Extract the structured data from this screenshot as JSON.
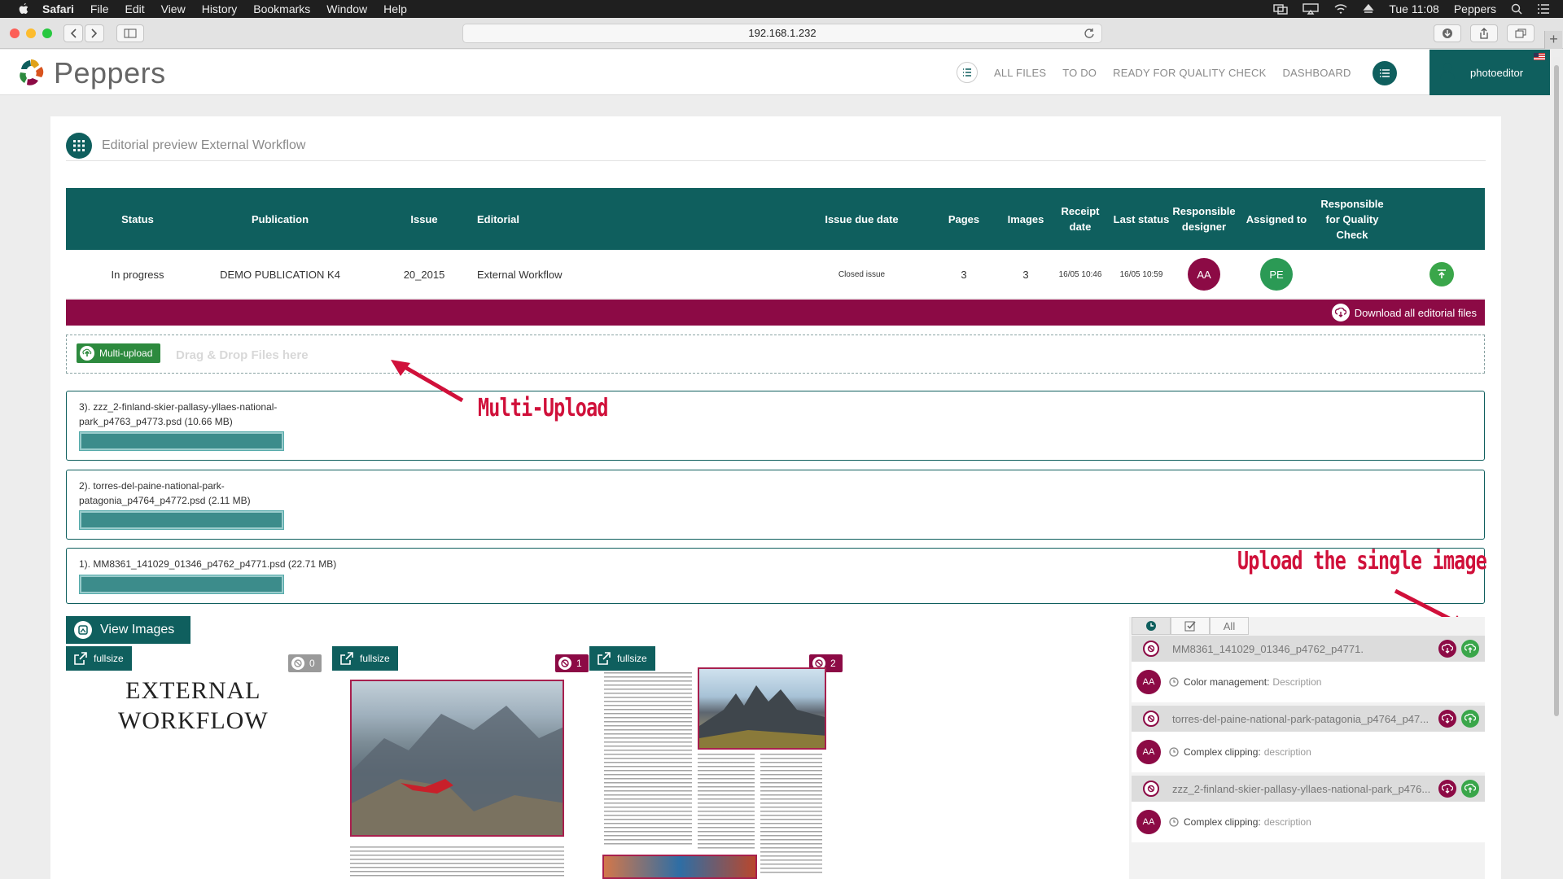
{
  "menubar": {
    "items": [
      "Safari",
      "File",
      "Edit",
      "View",
      "History",
      "Bookmarks",
      "Window",
      "Help"
    ],
    "clock": "Tue 11:08",
    "user": "Peppers"
  },
  "browser": {
    "url": "192.168.1.232"
  },
  "header": {
    "brand": "Peppers",
    "nav": [
      "ALL FILES",
      "TO DO",
      "READY FOR QUALITY CHECK",
      "DASHBOARD"
    ],
    "username": "photoeditor"
  },
  "page": {
    "title": "Editorial preview External Workflow"
  },
  "table": {
    "headers": {
      "status": "Status",
      "publication": "Publication",
      "issue": "Issue",
      "editorial": "Editorial",
      "issue_due_date": "Issue due date",
      "pages": "Pages",
      "images": "Images",
      "receipt_date_1": "Receipt",
      "receipt_date_2": "date",
      "last_status": "Last status",
      "responsible_designer_1": "Responsible",
      "responsible_designer_2": "designer",
      "assigned_to": "Assigned to",
      "responsible_qc_1": "Responsible",
      "responsible_qc_2": "for Quality",
      "responsible_qc_3": "Check"
    },
    "row": {
      "status": "In progress",
      "publication": "DEMO PUBLICATION K4",
      "issue": "20_2015",
      "editorial": "External Workflow",
      "issue_due_date": "Closed issue",
      "pages": "3",
      "images": "3",
      "receipt_date": "16/05 10:46",
      "last_status": "16/05 10:59",
      "designer": "AA",
      "assigned": "PE"
    }
  },
  "download_all": "Download all editorial files",
  "dropzone": {
    "button": "Multi-upload",
    "hint": "Drag & Drop Files here"
  },
  "uploads": [
    {
      "line1": "3). zzz_2-finland-skier-pallasy-yllaes-national-",
      "line2": "park_p4763_p4773.psd (10.66 MB)"
    },
    {
      "line1": "2). torres-del-paine-national-park-",
      "line2": "patagonia_p4764_p4772.psd (2.11 MB)"
    },
    {
      "line1": "1). MM8361_141029_01346_p4762_p4771.psd (22.71 MB)",
      "line2": ""
    }
  ],
  "progress": [
    1.0,
    1.0,
    1.0
  ],
  "annotations": {
    "multi_upload": "Multi-Upload",
    "single_upload": "Upload the single image"
  },
  "images": {
    "view_button": "View Images",
    "fullsize": "fullsize",
    "page1_title_1": "EXTERNAL",
    "page1_title_2": "WORKFLOW",
    "counts": [
      "0",
      "1",
      "2"
    ]
  },
  "tasks": {
    "tabs": [
      "All"
    ],
    "items": [
      {
        "file": "MM8361_141029_01346_p4762_p4771.",
        "user": "AA",
        "task": "Color management",
        "sep": " : ",
        "desc": "Description"
      },
      {
        "file": "torres-del-paine-national-park-patagonia_p4764_p47...",
        "user": "AA",
        "task": "Complex clipping",
        "sep": " : ",
        "desc": "description"
      },
      {
        "file": "zzz_2-finland-skier-pallasy-yllaes-national-park_p476...",
        "user": "AA",
        "task": "Complex clipping",
        "sep": " : ",
        "desc": "description"
      }
    ]
  },
  "colors": {
    "accent": "#0f5f5e",
    "brand_red": "#8c0a45",
    "success": "#3aa64a",
    "annotation": "#d0103a"
  }
}
